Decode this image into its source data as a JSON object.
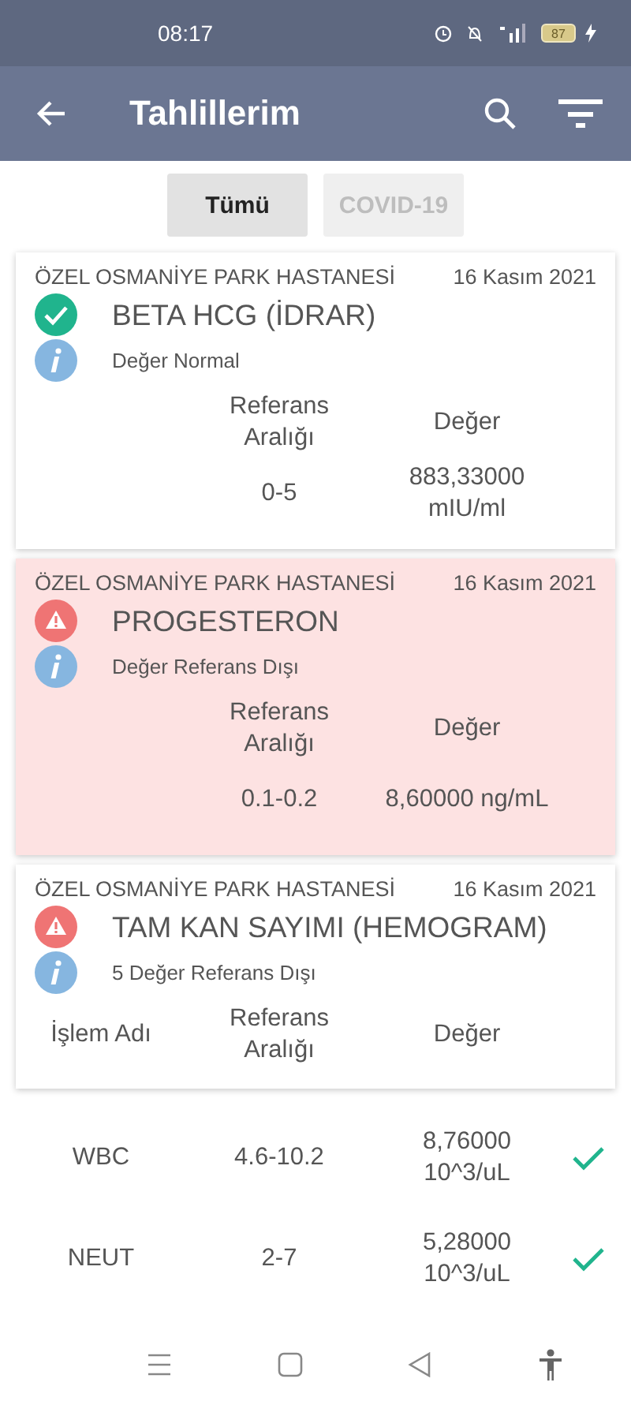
{
  "status_bar": {
    "time": "08:17",
    "battery": "87"
  },
  "app_bar": {
    "title": "Tahlillerim"
  },
  "filters": [
    {
      "label": "Tümü",
      "selected": true
    },
    {
      "label": "COVID-19",
      "selected": false
    }
  ],
  "results": [
    {
      "hospital": "ÖZEL OSMANİYE PARK HASTANESİ",
      "date": "16 Kasım 2021",
      "kind": "normal",
      "test": "BETA HCG (İDRAR)",
      "note": "Değer Normal",
      "columns": [
        "Referans Aralığı",
        "Değer"
      ],
      "rows": [
        {
          "reference": "0-5",
          "value": "883,33000 mIU/ml"
        }
      ]
    },
    {
      "hospital": "ÖZEL OSMANİYE PARK HASTANESİ",
      "date": "16 Kasım 2021",
      "kind": "abnormal",
      "highlighted": true,
      "test": "PROGESTERON",
      "note": "Değer Referans Dışı",
      "columns": [
        "Referans Aralığı",
        "Değer"
      ],
      "rows": [
        {
          "reference": "0.1-0.2",
          "value": "8,60000 ng/mL"
        }
      ]
    },
    {
      "hospital": "ÖZEL OSMANİYE PARK HASTANESİ",
      "date": "16 Kasım 2021",
      "kind": "abnormal",
      "highlighted": false,
      "test": "TAM KAN SAYIMI (HEMOGRAM)",
      "note": "5 Değer Referans Dışı",
      "columns": [
        "İşlem Adı",
        "Referans Aralığı",
        "Değer"
      ]
    }
  ],
  "detail_rows": [
    {
      "name": "WBC",
      "reference": "4.6-10.2",
      "value": "8,76000 10^3/uL",
      "normal": true
    },
    {
      "name": "NEUT",
      "reference": "2-7",
      "value": "5,28000 10^3/uL",
      "normal": true
    }
  ]
}
